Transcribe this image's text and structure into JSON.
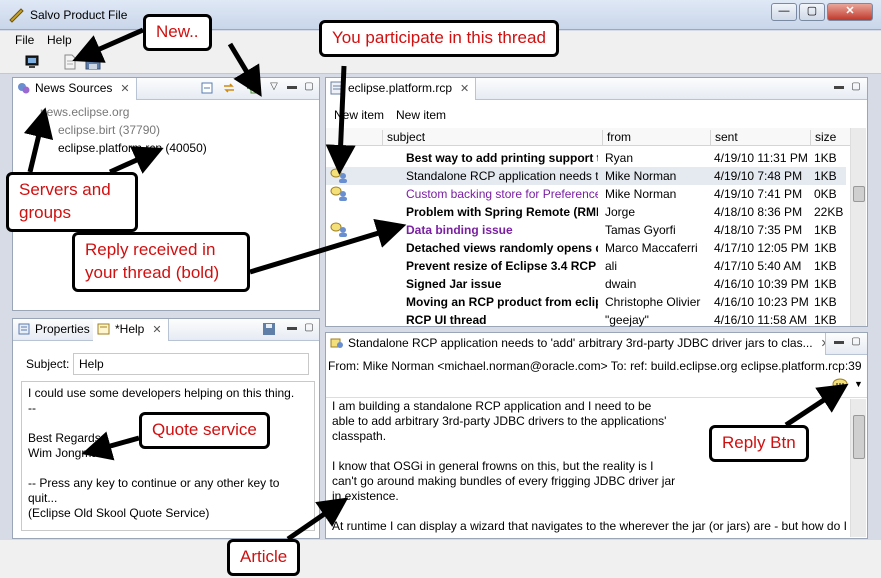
{
  "window": {
    "title": "Salvo Product File"
  },
  "menu": {
    "items": [
      "File",
      "Help"
    ]
  },
  "news_sources": {
    "tab_label": "News Sources",
    "tree": [
      {
        "label": "news.eclipse.org"
      },
      {
        "label": "eclipse.birt (37790)"
      },
      {
        "label": "eclipse.platform.rcp (40050)"
      }
    ]
  },
  "bottom_left": {
    "tabs": [
      "Properties",
      "*Help"
    ],
    "subject_label": "Subject:",
    "subject_value": "Help",
    "body_lines": [
      "I could use some developers helping on this thing.",
      "--",
      "",
      "Best Regards,",
      "Wim Jongman",
      "",
      "-- Press any key to continue or any other key to quit...",
      "(Eclipse Old Skool Quote Service)"
    ]
  },
  "thread_view": {
    "tab_label": "eclipse.platform.rcp",
    "actions": [
      "New item",
      "New item"
    ],
    "columns": [
      "subject",
      "from",
      "sent",
      "size"
    ],
    "rows": [
      {
        "subject": "Best way to add printing support to",
        "from": "Ryan",
        "sent": "4/19/10 11:31 PM",
        "size": "1KB",
        "style": "bold"
      },
      {
        "subject": "Standalone RCP application needs to",
        "from": "Mike Norman",
        "sent": "4/19/10 7:48 PM",
        "size": "1KB",
        "style": "normal"
      },
      {
        "subject": "Custom backing store for Preference",
        "from": "Mike Norman",
        "sent": "4/19/10 7:41 PM",
        "size": "0KB",
        "style": "purple"
      },
      {
        "subject": "Problem with Spring Remote (RMI",
        "from": "Jorge",
        "sent": "4/18/10 8:36 PM",
        "size": "22KB",
        "style": "bold"
      },
      {
        "subject": "Data binding issue",
        "from": "Tamas Gyorfi",
        "sent": "4/18/10 7:35 PM",
        "size": "1KB",
        "style": "purplebold"
      },
      {
        "subject": "Detached views randomly opens do",
        "from": "Marco Maccaferri",
        "sent": "4/17/10 12:05 PM",
        "size": "1KB",
        "style": "bold"
      },
      {
        "subject": "Prevent resize of Eclipse 3.4 RCP A",
        "from": "ali",
        "sent": "4/17/10 5:40 AM",
        "size": "1KB",
        "style": "bold"
      },
      {
        "subject": "Signed Jar issue",
        "from": "dwain",
        "sent": "4/16/10 10:39 PM",
        "size": "1KB",
        "style": "bold"
      },
      {
        "subject": "Moving an RCP product from eclips",
        "from": "Christophe Olivier",
        "sent": "4/16/10 10:23 PM",
        "size": "1KB",
        "style": "bold"
      },
      {
        "subject": "RCP UI thread",
        "from": "\"geejay\"",
        "sent": "4/16/10 11:58 AM",
        "size": "1KB",
        "style": "bold"
      }
    ]
  },
  "article": {
    "tab_label": "Standalone RCP application needs to 'add' arbitrary 3rd-party JDBC driver jars to clas...",
    "header": "From: Mike Norman <michael.norman@oracle.com>   To: ref: build.eclipse.org eclipse.platform.rcp:39",
    "body_lines": [
      "I am building a standalone RCP application and I need to be",
      "able to add arbitrary 3rd-party JDBC drivers to the applications'",
      "classpath.",
      "",
      "I know that OSGi in general frowns on this, but the reality is I",
      "can't go around making bundles of every frigging JDBC driver jar",
      "in existence.",
      "",
      "At runtime I can display a wizard that navigates to the wherever the jar (or jars) are - but how do I"
    ]
  },
  "annotations": {
    "new": "New..",
    "participate": "You participate in this thread",
    "servers": "Servers and groups",
    "reply_received": "Reply received in your thread (bold)",
    "quote": "Quote service",
    "reply_btn": "Reply Btn",
    "article": "Article"
  },
  "colors": {
    "purple": "#7a1fa2",
    "annotation_text": "#d01010"
  }
}
